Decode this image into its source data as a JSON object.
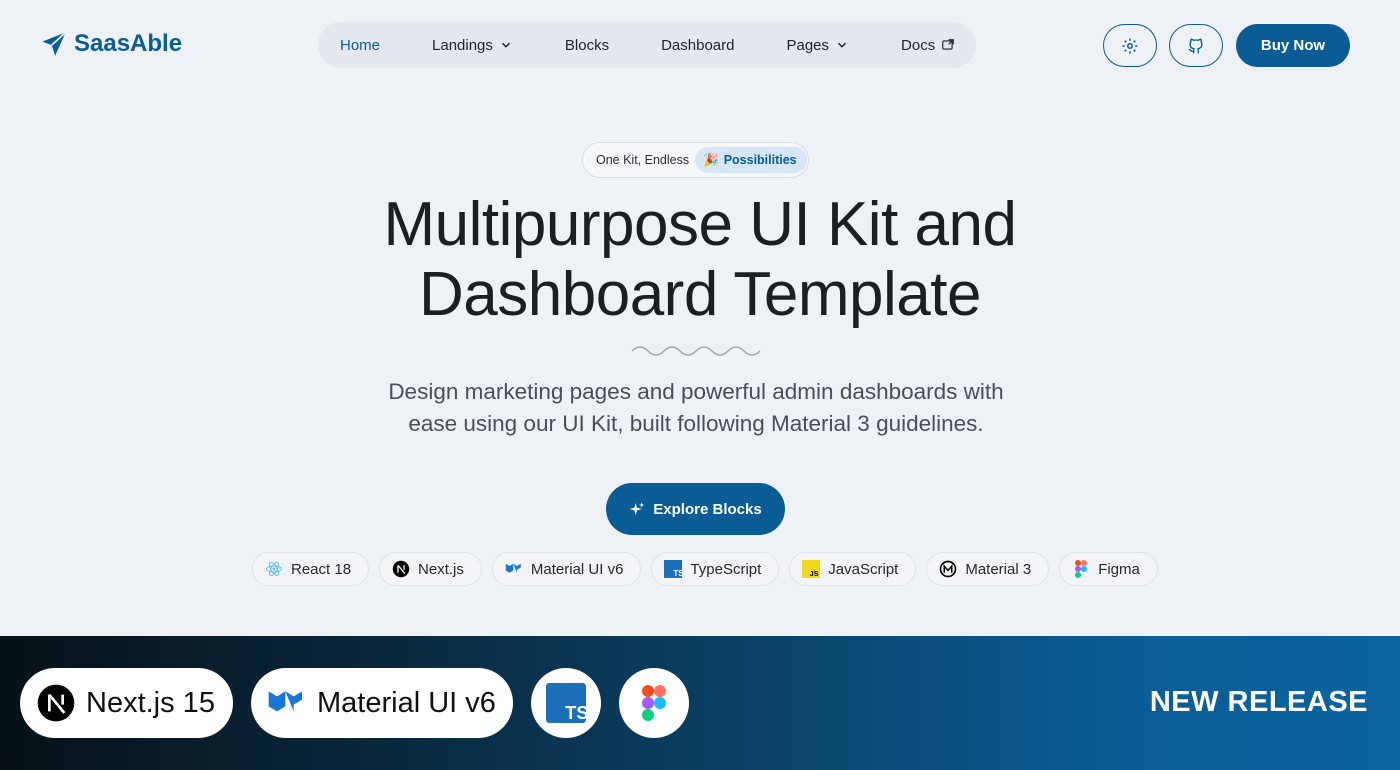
{
  "brand": {
    "name": "SaasAble",
    "logo_icon": "paper-plane-icon",
    "color": "#0a5c94"
  },
  "nav": {
    "items": [
      {
        "label": "Home",
        "active": true,
        "icon": ""
      },
      {
        "label": "Landings",
        "active": false,
        "icon": "chevron-down-icon"
      },
      {
        "label": "Blocks",
        "active": false,
        "icon": ""
      },
      {
        "label": "Dashboard",
        "active": false,
        "icon": ""
      },
      {
        "label": "Pages",
        "active": false,
        "icon": "chevron-down-icon"
      },
      {
        "label": "Docs",
        "active": false,
        "icon": "external-link-icon"
      }
    ]
  },
  "header_actions": {
    "settings_icon": "gear-icon",
    "github_icon": "github-icon",
    "buy_label": "Buy Now"
  },
  "hero": {
    "badge_text": "One Kit, Endless",
    "badge_pill": "Possibilities",
    "badge_icon": "party-popper-icon",
    "title_line1": "Multipurpose UI Kit and",
    "title_line2": "Dashboard Template",
    "subtitle_line1": "Design marketing pages and powerful admin dashboards with",
    "subtitle_line2": "ease using our UI Kit, built following Material 3 guidelines.",
    "cta_label": "Explore Blocks",
    "cta_icon": "sparkle-icon"
  },
  "tech_chips": [
    {
      "label": "React 18",
      "icon": "react-icon"
    },
    {
      "label": "Next.js",
      "icon": "nextjs-icon"
    },
    {
      "label": "Material UI v6",
      "icon": "mui-icon"
    },
    {
      "label": "TypeScript",
      "icon": "typescript-icon"
    },
    {
      "label": "JavaScript",
      "icon": "javascript-icon"
    },
    {
      "label": "Material 3",
      "icon": "material3-icon"
    },
    {
      "label": "Figma",
      "icon": "figma-icon"
    }
  ],
  "banner": {
    "nextjs_label": "Next.js 15",
    "mui_label": "Material UI v6",
    "ts_icon": "typescript-icon",
    "figma_icon": "figma-icon",
    "release_text": "NEW RELEASE"
  }
}
